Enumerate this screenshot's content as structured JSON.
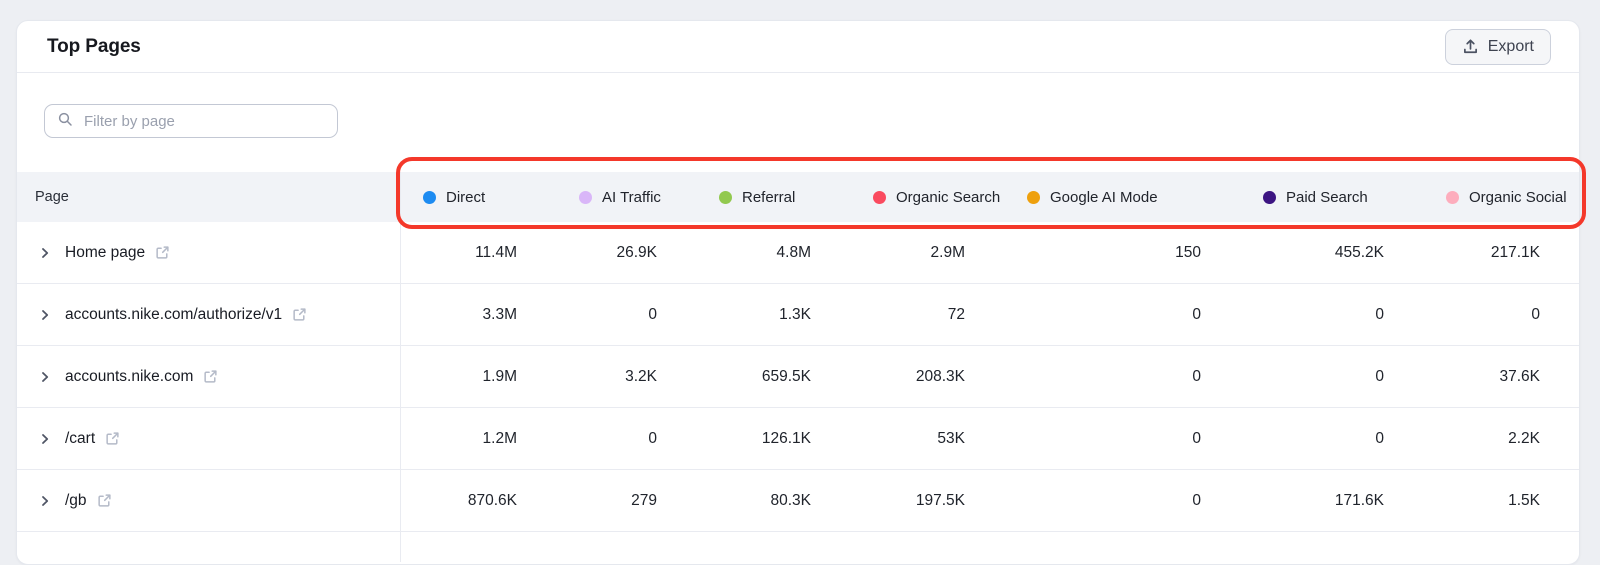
{
  "panel": {
    "title": "Top Pages",
    "export_label": "Export"
  },
  "filter": {
    "placeholder": "Filter by page",
    "value": ""
  },
  "icons": {
    "search": "magnifier",
    "export": "upload-arrow-tray",
    "row_expand": "chevron-right",
    "page_link": "external-link-arrow"
  },
  "annotation": {
    "shape": "rounded-rectangle-highlight",
    "color": "#f4382a"
  },
  "table": {
    "page_column_label": "Page",
    "columns": [
      {
        "label": "Direct",
        "color": "#1d8bf1"
      },
      {
        "label": "AI Traffic",
        "color": "#d9b6f8"
      },
      {
        "label": "Referral",
        "color": "#92c94f"
      },
      {
        "label": "Organic Search",
        "color": "#fa4a5f"
      },
      {
        "label": "Google AI Mode",
        "color": "#eea00e"
      },
      {
        "label": "Paid Search",
        "color": "#3c1482"
      },
      {
        "label": "Organic Social",
        "color": "#fdadbd"
      }
    ],
    "rows": [
      {
        "page": "Home page",
        "values": [
          "11.4M",
          "26.9K",
          "4.8M",
          "2.9M",
          "150",
          "455.2K",
          "217.1K"
        ]
      },
      {
        "page": "accounts.nike.com/authorize/v1",
        "values": [
          "3.3M",
          "0",
          "1.3K",
          "72",
          "0",
          "0",
          "0"
        ]
      },
      {
        "page": "accounts.nike.com",
        "values": [
          "1.9M",
          "3.2K",
          "659.5K",
          "208.3K",
          "0",
          "0",
          "37.6K"
        ]
      },
      {
        "page": "/cart",
        "values": [
          "1.2M",
          "0",
          "126.1K",
          "53K",
          "0",
          "0",
          "2.2K"
        ]
      },
      {
        "page": "/gb",
        "values": [
          "870.6K",
          "279",
          "80.3K",
          "197.5K",
          "0",
          "171.6K",
          "1.5K"
        ]
      }
    ]
  }
}
